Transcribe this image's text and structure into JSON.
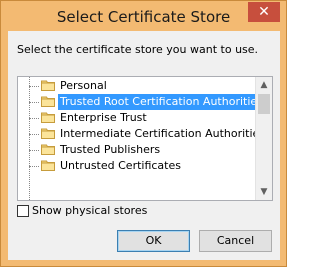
{
  "window": {
    "title": "Select Certificate Store",
    "close_label": "✕"
  },
  "prompt": "Select the certificate store you want to use.",
  "tree": {
    "items": [
      {
        "label": "Personal",
        "selected": false
      },
      {
        "label": "Trusted Root Certification Authorities",
        "selected": true
      },
      {
        "label": "Enterprise Trust",
        "selected": false
      },
      {
        "label": "Intermediate Certification Authorities",
        "selected": false
      },
      {
        "label": "Trusted Publishers",
        "selected": false
      },
      {
        "label": "Untrusted Certificates",
        "selected": false
      }
    ]
  },
  "scrollbar": {
    "up_label": "▲",
    "down_label": "▼"
  },
  "show_physical": {
    "label": "Show physical stores",
    "checked": false
  },
  "buttons": {
    "ok": "OK",
    "cancel": "Cancel"
  },
  "colors": {
    "titlebar": "#f3ba72",
    "selection": "#3399ff",
    "close": "#c74f3d"
  }
}
